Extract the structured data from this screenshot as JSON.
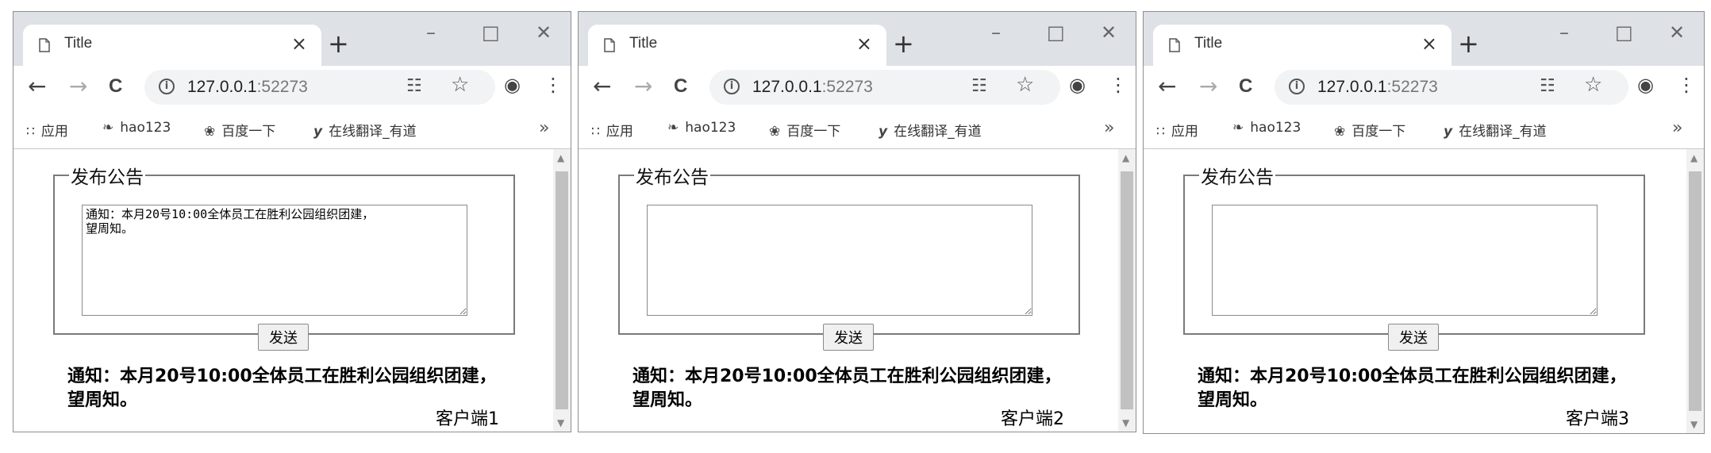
{
  "windows": [
    {
      "tab_title": "Title",
      "url_host": "127.0.0.1",
      "url_port": ":52273",
      "bookmarks": [
        {
          "icon": "apps-grid-icon",
          "glyph": "∷",
          "label": "应用"
        },
        {
          "icon": "hao123-icon",
          "glyph": "❧",
          "label": "hao123"
        },
        {
          "icon": "baidu-paw-icon",
          "glyph": "❀",
          "label": "百度一下"
        },
        {
          "icon": "youdao-icon",
          "glyph": "y",
          "label": "在线翻译_有道"
        }
      ],
      "legend": "发布公告",
      "textarea_value": "通知：本月20号10:00全体员工在胜利公园组织团建，\n望周知。",
      "send_label": "发送",
      "notice_line1": "通知：本月20号10:00全体员工在胜利公园组织团建，",
      "notice_line2": "望周知。",
      "client_label": "客户端1"
    },
    {
      "tab_title": "Title",
      "url_host": "127.0.0.1",
      "url_port": ":52273",
      "bookmarks": [
        {
          "icon": "apps-grid-icon",
          "glyph": "∷",
          "label": "应用"
        },
        {
          "icon": "hao123-icon",
          "glyph": "❧",
          "label": "hao123"
        },
        {
          "icon": "baidu-paw-icon",
          "glyph": "❀",
          "label": "百度一下"
        },
        {
          "icon": "youdao-icon",
          "glyph": "y",
          "label": "在线翻译_有道"
        }
      ],
      "legend": "发布公告",
      "textarea_value": "",
      "send_label": "发送",
      "notice_line1": "通知：本月20号10:00全体员工在胜利公园组织团建，",
      "notice_line2": "望周知。",
      "client_label": "客户端2"
    },
    {
      "tab_title": "Title",
      "url_host": "127.0.0.1",
      "url_port": ":52273",
      "bookmarks": [
        {
          "icon": "apps-grid-icon",
          "glyph": "∷",
          "label": "应用"
        },
        {
          "icon": "hao123-icon",
          "glyph": "❧",
          "label": "hao123"
        },
        {
          "icon": "baidu-paw-icon",
          "glyph": "❀",
          "label": "百度一下"
        },
        {
          "icon": "youdao-icon",
          "glyph": "y",
          "label": "在线翻译_有道"
        }
      ],
      "legend": "发布公告",
      "textarea_value": "",
      "send_label": "发送",
      "notice_line1": "通知：本月20号10:00全体员工在胜利公园组织团建，",
      "notice_line2": "望周知。",
      "client_label": "客户端3"
    }
  ],
  "icons": {
    "minimize": "–",
    "maximize": "□",
    "close": "✕",
    "tab_close": "×",
    "new_tab": "+",
    "back": "←",
    "forward": "→",
    "reload": "C",
    "info": "i",
    "translate": "☷",
    "star": "☆",
    "account": "◉",
    "menu": "⋮",
    "more_bookmarks": "»",
    "scroll_up": "▲",
    "scroll_down": "▼"
  }
}
